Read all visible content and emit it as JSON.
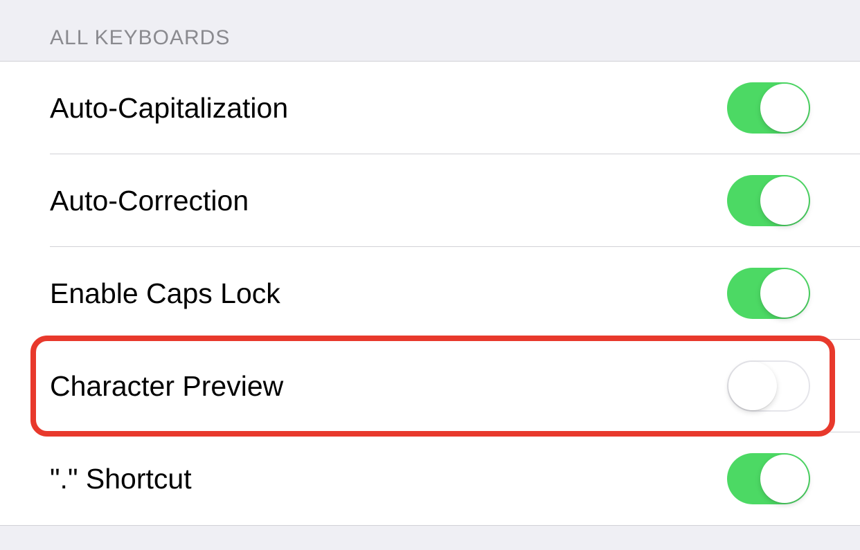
{
  "section": {
    "header": "ALL KEYBOARDS"
  },
  "settings": [
    {
      "label": "Auto-Capitalization",
      "enabled": true,
      "name": "auto-capitalization"
    },
    {
      "label": "Auto-Correction",
      "enabled": true,
      "name": "auto-correction"
    },
    {
      "label": "Enable Caps Lock",
      "enabled": true,
      "name": "enable-caps-lock"
    },
    {
      "label": "Character Preview",
      "enabled": false,
      "name": "character-preview",
      "highlighted": true
    },
    {
      "label": "\".\" Shortcut",
      "enabled": true,
      "name": "period-shortcut"
    }
  ],
  "colors": {
    "toggle_on": "#4cd964",
    "toggle_off_border": "#e5e5ea",
    "highlight": "#e8392c",
    "background": "#efeff4",
    "row_background": "#ffffff",
    "separator": "#d1d1d6",
    "header_text": "#8a8a8f",
    "label_text": "#000000"
  }
}
